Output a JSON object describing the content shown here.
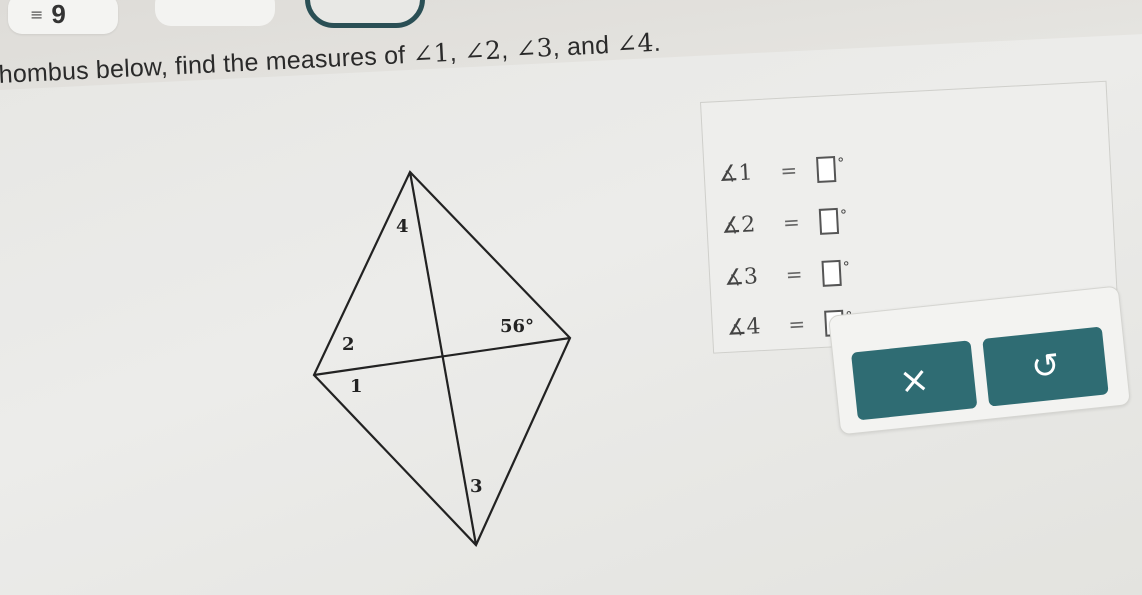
{
  "header": {
    "menu_icon": "≡",
    "menu_count": "9"
  },
  "prompt": {
    "text_before": "hombus below, find the measures of ",
    "angle_1": "∠1",
    "angle_2": "∠2",
    "angle_3": "∠3",
    "and_word": "and",
    "angle_4": "∠4",
    "sep": ", ",
    "end": "."
  },
  "figure": {
    "labels": {
      "label_4": "4",
      "label_2": "2",
      "label_1": "1",
      "label_3": "3",
      "label_given": "56°"
    }
  },
  "answers": {
    "rows": [
      {
        "angle": "∡1",
        "eq": "=",
        "deg": "°"
      },
      {
        "angle": "∡2",
        "eq": "=",
        "deg": "°"
      },
      {
        "angle": "∡3",
        "eq": "=",
        "deg": "°"
      },
      {
        "angle": "∡4",
        "eq": "=",
        "deg": "°"
      }
    ]
  },
  "buttons": {
    "clear_glyph": "×",
    "undo_glyph": "↺"
  },
  "icons": {
    "menu": "menu-icon",
    "clear": "close-icon",
    "undo": "undo-icon"
  },
  "colors": {
    "button": "#2f6c73",
    "dark_outline": "#2a4f55"
  }
}
